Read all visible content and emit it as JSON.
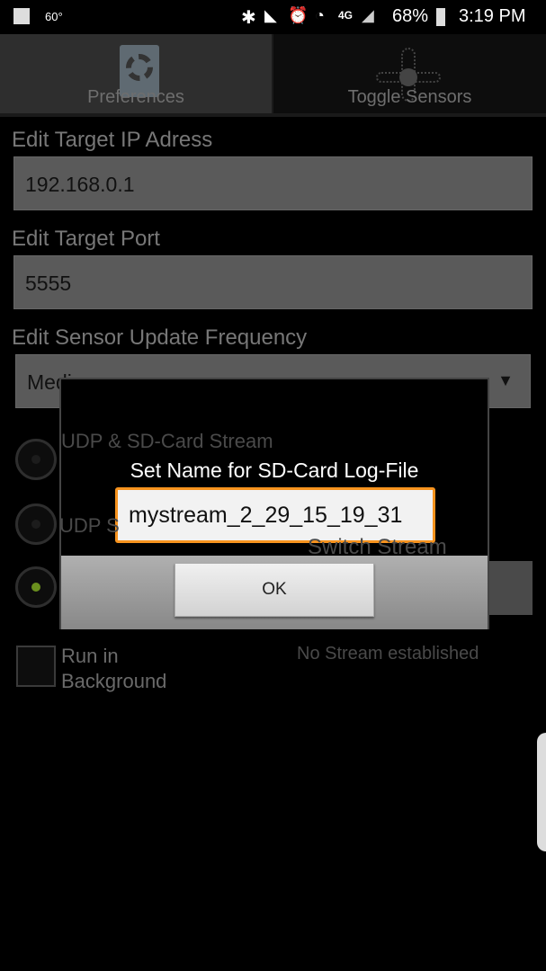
{
  "status_bar": {
    "temperature": "60°",
    "battery": "68%",
    "time": "3:19 PM",
    "icons": [
      "gallery-icon",
      "bluetooth-icon",
      "mute-icon",
      "alarm-icon",
      "wifi-icon",
      "4g-icon",
      "signal-icon",
      "battery-icon"
    ]
  },
  "tabs": [
    {
      "label": "Preferences",
      "icon": "gear-document-icon",
      "active": true
    },
    {
      "label": "Toggle Sensors",
      "icon": "sensor-springs-icon",
      "active": false
    }
  ],
  "form": {
    "ip_label": "Edit Target IP Adress",
    "ip_value": "192.168.0.1",
    "port_label": "Edit Target Port",
    "port_value": "5555",
    "freq_label": "Edit Sensor Update Frequency",
    "freq_value": "Medium",
    "radio1": "UDP & SD-Card Stream",
    "radio2": "UDP S",
    "status_text": "No Stream established",
    "switch_label": "Switch Stream",
    "run_bg": "Run in Background"
  },
  "dialog": {
    "title": "Set Name for SD-Card Log-File",
    "input_value": "mystream_2_29_15_19_31",
    "ok": "OK"
  },
  "colors": {
    "accent": "#f7931e",
    "radio_selected": "#6a8f1e"
  }
}
